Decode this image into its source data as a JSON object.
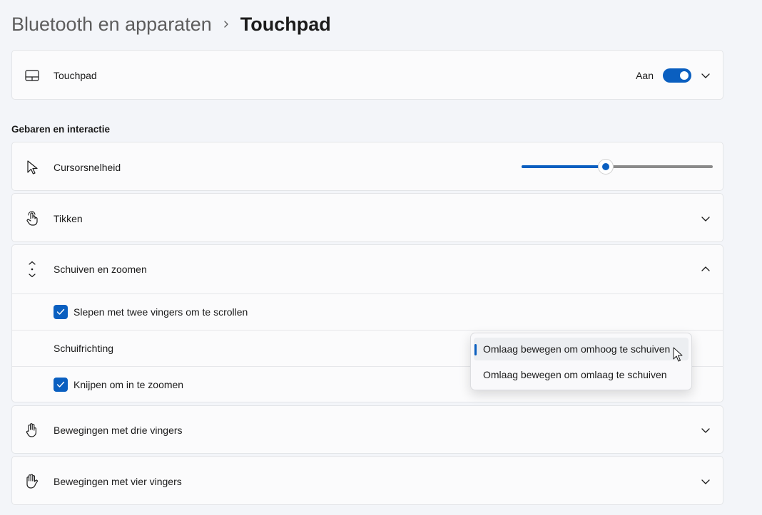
{
  "breadcrumb": {
    "parent": "Bluetooth en apparaten",
    "current": "Touchpad"
  },
  "touchpad_card": {
    "label": "Touchpad",
    "toggle_text": "Aan",
    "toggle_on": true
  },
  "section_title": "Gebaren en interactie",
  "cursor_speed": {
    "label": "Cursorsnelheid",
    "value_fraction": 0.44
  },
  "tap": {
    "label": "Tikken"
  },
  "scroll_zoom": {
    "label": "Schuiven en zoomen",
    "expanded": true,
    "two_finger_scroll": {
      "label": "Slepen met twee vingers om te scrollen",
      "checked": true
    },
    "scroll_direction": {
      "label": "Schuifrichting",
      "options": [
        "Omlaag bewegen om omhoog te schuiven",
        "Omlaag bewegen om omlaag te schuiven"
      ],
      "selected_index": 0
    },
    "pinch_zoom": {
      "label": "Knijpen om in te zoomen",
      "checked": true
    }
  },
  "three_finger": {
    "label": "Bewegingen met drie vingers"
  },
  "four_finger": {
    "label": "Bewegingen met vier vingers"
  },
  "colors": {
    "accent": "#0a5fc0",
    "background": "#f3f5f9",
    "card": "#fbfbfc"
  }
}
